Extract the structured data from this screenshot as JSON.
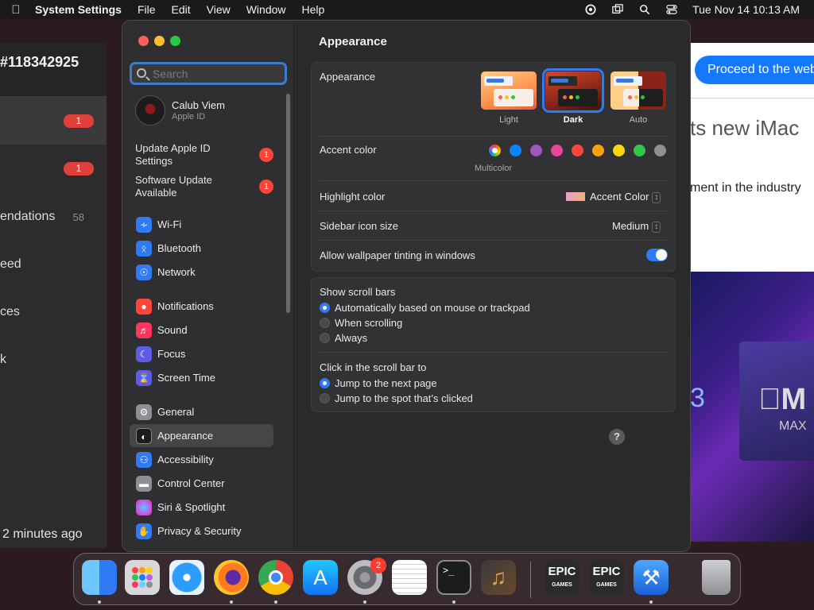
{
  "menubar": {
    "app_name": "System Settings",
    "menus": [
      "File",
      "Edit",
      "View",
      "Window",
      "Help"
    ],
    "clock": "Tue Nov 14  10:13 AM"
  },
  "bg_left": {
    "title": "#118342925",
    "rows": [
      {
        "label": "",
        "badge": "1"
      },
      {
        "label": "",
        "badge": "1"
      },
      {
        "label": "endations",
        "count": "58"
      },
      {
        "label": "eed"
      },
      {
        "label": "ces"
      },
      {
        "label": "k"
      }
    ],
    "footer": "2 minutes ago"
  },
  "bg_right": {
    "button": "Proceed to the web",
    "headline": "ts new iMac",
    "subtext": "ment in the industry",
    "hero_number": "3",
    "hero_max": "MAX"
  },
  "sidebar": {
    "search_placeholder": "Search",
    "account": {
      "name": "Calub Viem",
      "subtitle": "Apple ID"
    },
    "notices": [
      {
        "line1": "Update Apple ID",
        "line2": "Settings",
        "badge": "1"
      },
      {
        "line1": "Software Update",
        "line2": "Available",
        "badge": "1"
      }
    ],
    "items": [
      {
        "label": "Wi-Fi",
        "icon": "wifi-icon",
        "color": "#2f7bf5"
      },
      {
        "label": "Bluetooth",
        "icon": "bluetooth-icon",
        "color": "#2f7bf5"
      },
      {
        "label": "Network",
        "icon": "globe-icon",
        "color": "#2f7bf5"
      },
      {
        "label": "Notifications",
        "icon": "bell-icon",
        "color": "#ff453a"
      },
      {
        "label": "Sound",
        "icon": "speaker-icon",
        "color": "#ff375f"
      },
      {
        "label": "Focus",
        "icon": "moon-icon",
        "color": "#5e5ce6"
      },
      {
        "label": "Screen Time",
        "icon": "hourglass-icon",
        "color": "#5e5ce6"
      },
      {
        "label": "General",
        "icon": "gear-icon",
        "color": "#8e8e93"
      },
      {
        "label": "Appearance",
        "icon": "appearance-icon",
        "color": "#1c1c1e"
      },
      {
        "label": "Accessibility",
        "icon": "accessibility-icon",
        "color": "#2f7bf5"
      },
      {
        "label": "Control Center",
        "icon": "toggles-icon",
        "color": "#8e8e93"
      },
      {
        "label": "Siri & Spotlight",
        "icon": "siri-icon",
        "color": "#bf5af2"
      },
      {
        "label": "Privacy & Security",
        "icon": "hand-icon",
        "color": "#2f7bf5"
      }
    ],
    "selected": "Appearance"
  },
  "content": {
    "title": "Appearance",
    "appearance": {
      "label": "Appearance",
      "options": [
        "Light",
        "Dark",
        "Auto"
      ],
      "selected": "Dark"
    },
    "accent": {
      "label": "Accent color",
      "caption": "Multicolor",
      "colors": [
        "#0a84ff",
        "#9f56bf",
        "#e8459a",
        "#ff453a",
        "#ff9f0a",
        "#ffd60a",
        "#32c74b",
        "#8e8e93"
      ]
    },
    "highlight": {
      "label": "Highlight color",
      "value": "Accent Color"
    },
    "sidebar_icon_size": {
      "label": "Sidebar icon size",
      "value": "Medium"
    },
    "wallpaper_tinting": {
      "label": "Allow wallpaper tinting in windows",
      "enabled": true
    },
    "scroll_bars": {
      "label": "Show scroll bars",
      "options": [
        "Automatically based on mouse or trackpad",
        "When scrolling",
        "Always"
      ],
      "selected": 0
    },
    "click_scroll": {
      "label": "Click in the scroll bar to",
      "options": [
        "Jump to the next page",
        "Jump to the spot that’s clicked"
      ],
      "selected": 0
    },
    "help": "?"
  },
  "dock": {
    "apps": [
      "finder-icon",
      "launchpad-icon",
      "safari-icon",
      "firefox-icon",
      "chrome-icon",
      "app-store-icon",
      "system-settings-icon",
      "textedit-icon",
      "terminal-icon",
      "garageband-icon",
      "epic-games-icon",
      "epic-games-icon",
      "xcode-icon",
      "trash-icon"
    ],
    "settings_badge": "2",
    "epic_line1": "EPIC",
    "epic_line2": "GAMES",
    "terminal_prompt": ">_"
  }
}
